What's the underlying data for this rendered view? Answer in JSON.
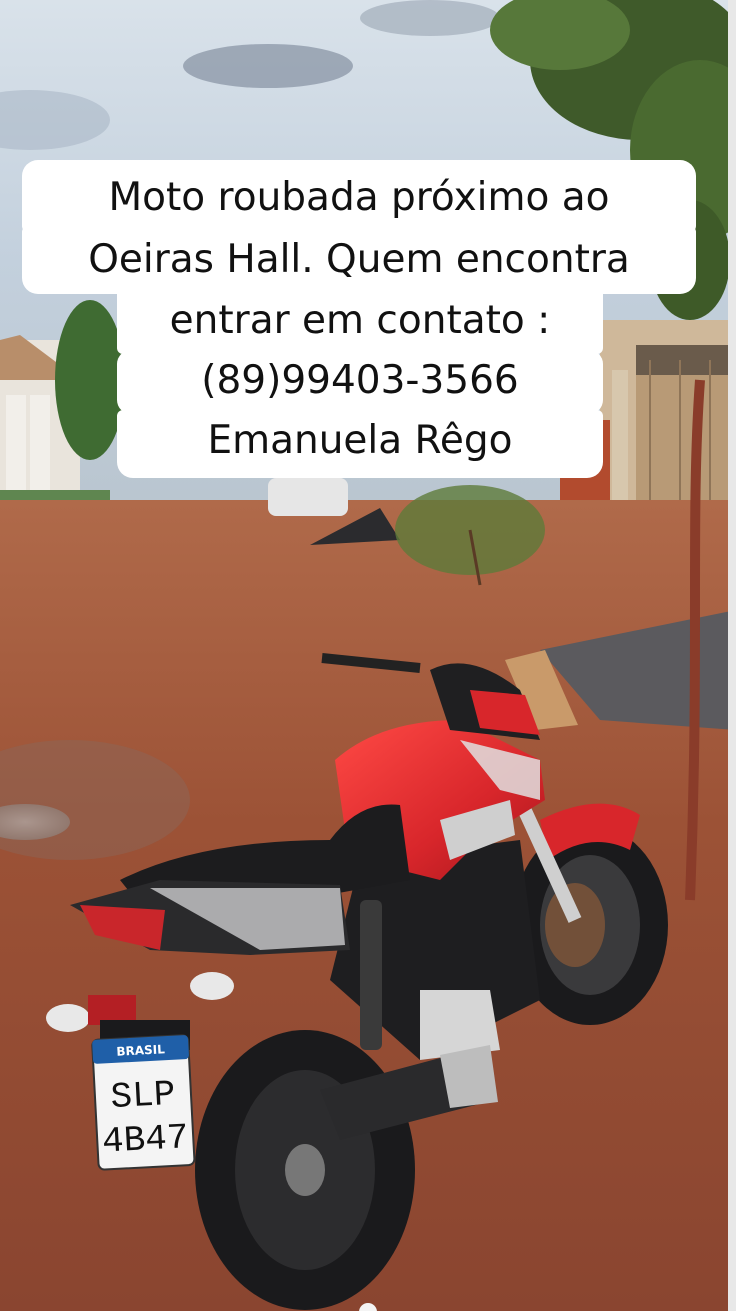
{
  "caption": {
    "lines": [
      "Moto roubada próximo ao",
      "Oeiras Hall. Quem encontra",
      "entrar em contato :",
      "(89)99403-3566",
      "Emanuela Rêgo"
    ]
  },
  "plate": {
    "country": "BRASIL",
    "line1": "SLP",
    "line2": "4B47"
  },
  "colors": {
    "bike_red": "#d8262b",
    "dirt": "#9a4f34",
    "sky": "#c9d6e2"
  }
}
